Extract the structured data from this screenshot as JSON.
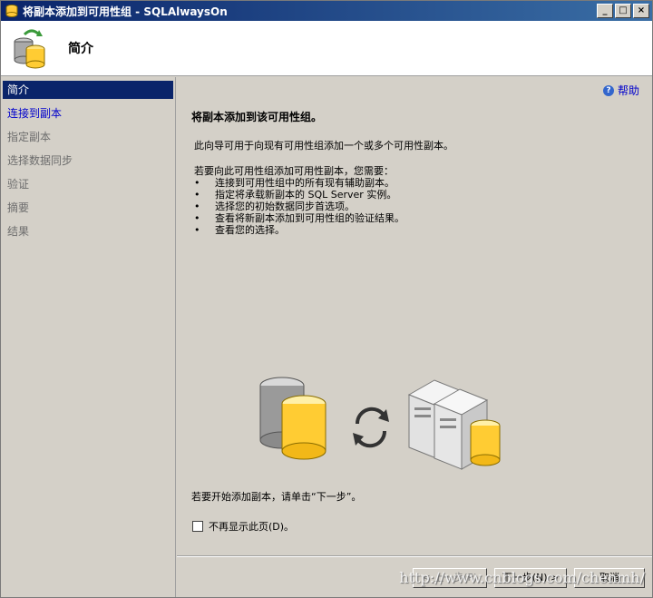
{
  "window": {
    "title": "将副本添加到可用性组 - SQLAlwaysOn",
    "minimize_glyph": "_",
    "maximize_glyph": "□",
    "close_glyph": "×",
    "app_icon": "database-add-icon"
  },
  "header": {
    "title": "简介",
    "icon": "database-sync-icon"
  },
  "sidebar": {
    "items": [
      {
        "label": "简介",
        "state": "active"
      },
      {
        "label": "连接到副本",
        "state": "link"
      },
      {
        "label": "指定副本",
        "state": "disabled"
      },
      {
        "label": "选择数据同步",
        "state": "disabled"
      },
      {
        "label": "验证",
        "state": "disabled"
      },
      {
        "label": "摘要",
        "state": "disabled"
      },
      {
        "label": "结果",
        "state": "disabled"
      }
    ]
  },
  "main": {
    "help_label": "帮助",
    "heading": "将副本添加到该可用性组。",
    "intro": "此向导可用于向现有可用性组添加一个或多个可用性副本。",
    "requirements_title": "若要向此可用性组添加可用性副本，您需要：",
    "bullets": [
      "连接到可用性组中的所有现有辅助副本。",
      "指定将承载新副本的 SQL Server 实例。",
      "选择您的初始数据同步首选项。",
      "查看将新副本添加到可用性组的验证结果。",
      "查看您的选择。"
    ],
    "bullet_glyph": "•",
    "next_hint": "若要开始添加副本，请单击“下一步”。",
    "dont_show_label": "不再显示此页(D)。",
    "dont_show_checked": false
  },
  "buttons": {
    "previous": "< 上一步(P)",
    "next": "下一步(N) >",
    "cancel": "取消"
  },
  "watermark": "http://www.cnblogs.com/chenmh/",
  "colors": {
    "titlebar_start": "#0a246a",
    "titlebar_end": "#3a6ea5",
    "selection": "#0a246a",
    "link": "#0000cc",
    "dialog_bg": "#d4d0c8"
  }
}
